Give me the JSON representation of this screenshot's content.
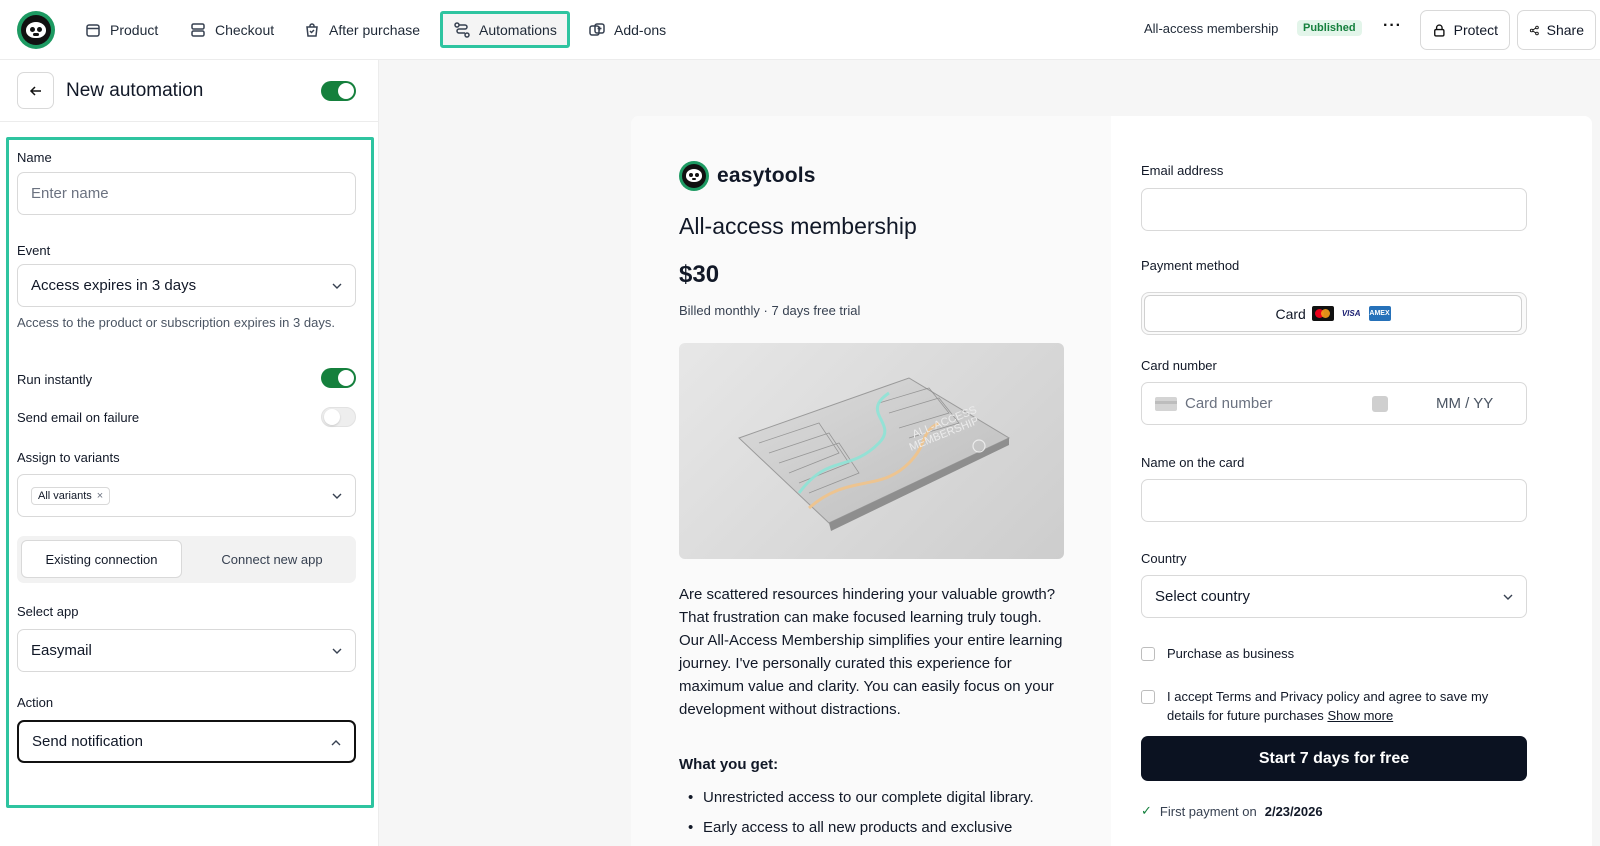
{
  "nav": {
    "items": [
      {
        "label": "Product",
        "icon": "box-icon"
      },
      {
        "label": "Checkout",
        "icon": "checkout-icon"
      },
      {
        "label": "After purchase",
        "icon": "bag-icon"
      },
      {
        "label": "Automations",
        "icon": "automations-icon",
        "active": true
      },
      {
        "label": "Add-ons",
        "icon": "add-ons-icon"
      }
    ],
    "product_name": "All-access membership",
    "status": "Published",
    "more": "···",
    "protect": "Protect",
    "share": "Share"
  },
  "panel": {
    "title": "New automation",
    "enabled": true,
    "name_label": "Name",
    "name_placeholder": "Enter name",
    "event_label": "Event",
    "event_value": "Access expires in 3 days",
    "event_help": "Access to the product or subscription expires in 3 days.",
    "run_instantly_label": "Run instantly",
    "run_instantly": true,
    "send_email_label": "Send email on failure",
    "send_email": false,
    "variants_label": "Assign to variants",
    "variant_chip": "All variants",
    "seg_existing": "Existing connection",
    "seg_new": "Connect new app",
    "app_label": "Select app",
    "app_value": "Easymail",
    "action_label": "Action",
    "action_value": "Send notification"
  },
  "checkout": {
    "brand": "easytools",
    "title": "All-access membership",
    "price": "$30",
    "billing": "Billed monthly · 7 days free trial",
    "card_text_1": "ALL-ACCESS",
    "card_text_2": "MEMBERSHIP",
    "description": "Are scattered resources hindering your valuable growth? That frustration can make focused learning truly tough. Our All-Access Membership simplifies your entire learning journey. I've personally curated this experience for maximum value and clarity. You can easily focus on your development without distractions.",
    "what_heading": "What you get:",
    "bullets": [
      "Unrestricted access to our complete digital library.",
      "Early access to all new products and exclusive"
    ],
    "email_label": "Email address",
    "payment_label": "Payment method",
    "payment_card": "Card",
    "visa": "VISA",
    "amex": "AMEX",
    "card_number_label": "Card number",
    "card_number_placeholder": "Card number",
    "expiry_placeholder": "MM / YY",
    "name_on_card_label": "Name on the card",
    "country_label": "Country",
    "country_placeholder": "Select country",
    "business_label": "Purchase as business",
    "terms_text": "I accept Terms and Privacy policy and agree to save my details for future purchases",
    "show_more": "Show more",
    "cta": "Start 7 days for free",
    "first_payment_prefix": "First payment on",
    "first_payment_date": "2/23/2026"
  },
  "colors": {
    "accent_highlight": "#2ec4a0",
    "toggle_on": "#15803d",
    "cta_bg": "#0b1221",
    "brand_green": "#1d9a62"
  }
}
